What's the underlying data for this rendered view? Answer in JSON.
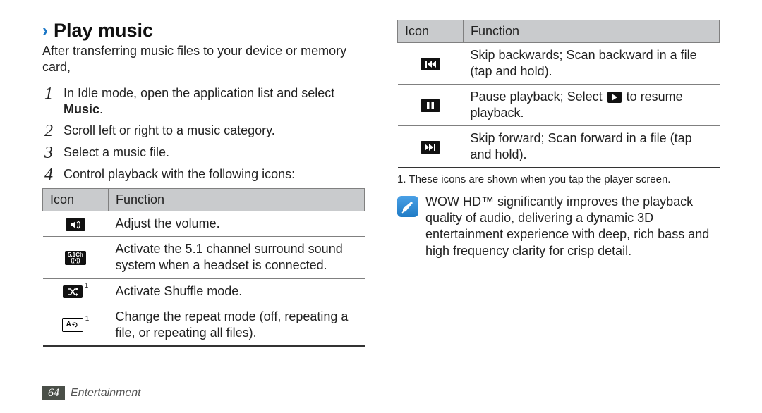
{
  "heading": "Play music",
  "intro": "After transferring music files to your device or memory card,",
  "steps": [
    {
      "num": "1",
      "text_pre": "In Idle mode, open the application list and select ",
      "bold": "Music",
      "text_post": "."
    },
    {
      "num": "2",
      "text_pre": "Scroll left or right to a music category.",
      "bold": "",
      "text_post": ""
    },
    {
      "num": "3",
      "text_pre": "Select a music file.",
      "bold": "",
      "text_post": ""
    },
    {
      "num": "4",
      "text_pre": "Control playback with the following icons:",
      "bold": "",
      "text_post": ""
    }
  ],
  "table1": {
    "headers": {
      "icon": "Icon",
      "func": "Function"
    },
    "rows": [
      {
        "icon_name": "volume-icon",
        "sup": "",
        "func": "Adjust the volume."
      },
      {
        "icon_name": "surround-5-1-icon",
        "sup": "",
        "func": "Activate the 5.1 channel surround sound system when a headset is connected."
      },
      {
        "icon_name": "shuffle-icon",
        "sup": "1",
        "func": "Activate Shuffle mode."
      },
      {
        "icon_name": "repeat-icon",
        "sup": "1",
        "func": "Change the repeat mode (off, repeating a file, or repeating all files)."
      }
    ]
  },
  "table2": {
    "headers": {
      "icon": "Icon",
      "func": "Function"
    },
    "rows": [
      {
        "icon_name": "skip-backward-icon",
        "func": "Skip backwards; Scan backward in a file (tap and hold)."
      },
      {
        "icon_name": "pause-icon",
        "func_pre": "Pause playback; Select ",
        "inline_icon": "play-icon",
        "func_post": " to resume playback."
      },
      {
        "icon_name": "skip-forward-icon",
        "func": "Skip forward; Scan forward in a file (tap and hold)."
      }
    ]
  },
  "footnote": "1. These icons are shown when you tap the player screen.",
  "note": "WOW HD™ significantly improves the playback quality of audio, delivering a dynamic 3D entertainment experience with deep, rich bass and high frequency clarity for crisp detail.",
  "footer": {
    "page": "64",
    "section": "Entertainment"
  }
}
